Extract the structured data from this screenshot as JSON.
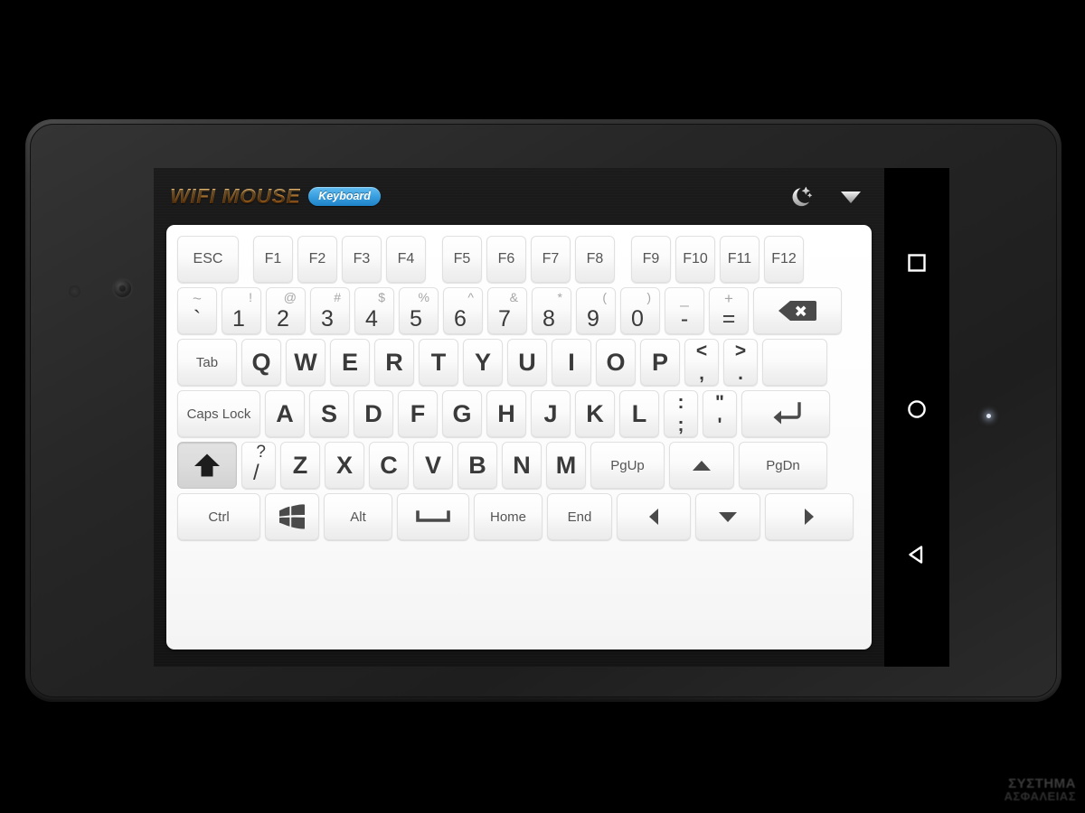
{
  "app": {
    "brand": "WIFI MOUSE",
    "mode_badge": "Keyboard",
    "icons": {
      "night_mode": "moon-icon",
      "dropdown": "chevron-down-icon"
    }
  },
  "colors": {
    "brand_orange": "#e09a3c",
    "badge_blue": "#3aa0e0",
    "key_face": "#fbfbfb",
    "key_pressed": "#dcdcdc",
    "panel_white": "#ffffff",
    "app_background": "#161616"
  },
  "keyboard": {
    "rows": [
      {
        "name": "function-row",
        "keys": [
          {
            "name": "esc",
            "label": "ESC",
            "style": "fn",
            "width": 68
          },
          {
            "gap": 16
          },
          {
            "name": "f1",
            "label": "F1",
            "style": "fn",
            "width": 44
          },
          {
            "name": "f2",
            "label": "F2",
            "style": "fn",
            "width": 44
          },
          {
            "name": "f3",
            "label": "F3",
            "style": "fn",
            "width": 44
          },
          {
            "name": "f4",
            "label": "F4",
            "style": "fn",
            "width": 44
          },
          {
            "gap": 18
          },
          {
            "name": "f5",
            "label": "F5",
            "style": "fn",
            "width": 44
          },
          {
            "name": "f6",
            "label": "F6",
            "style": "fn",
            "width": 44
          },
          {
            "name": "f7",
            "label": "F7",
            "style": "fn",
            "width": 44
          },
          {
            "name": "f8",
            "label": "F8",
            "style": "fn",
            "width": 44
          },
          {
            "gap": 18
          },
          {
            "name": "f9",
            "label": "F9",
            "style": "fn",
            "width": 44
          },
          {
            "name": "f10",
            "label": "F10",
            "style": "fn",
            "width": 44
          },
          {
            "name": "f11",
            "label": "F11",
            "style": "fn",
            "width": 44
          },
          {
            "name": "f12",
            "label": "F12",
            "style": "fn",
            "width": 44
          }
        ]
      },
      {
        "name": "number-row",
        "keys": [
          {
            "name": "backquote",
            "top": "~",
            "bottom": "`",
            "style": "dual-center",
            "width": 44
          },
          {
            "name": "digit-1",
            "top": "!",
            "bottom": "1",
            "style": "dual",
            "width": 44
          },
          {
            "name": "digit-2",
            "top": "@",
            "bottom": "2",
            "style": "dual",
            "width": 44
          },
          {
            "name": "digit-3",
            "top": "#",
            "bottom": "3",
            "style": "dual",
            "width": 44
          },
          {
            "name": "digit-4",
            "top": "$",
            "bottom": "4",
            "style": "dual",
            "width": 44
          },
          {
            "name": "digit-5",
            "top": "%",
            "bottom": "5",
            "style": "dual",
            "width": 44
          },
          {
            "name": "digit-6",
            "top": "^",
            "bottom": "6",
            "style": "dual",
            "width": 44
          },
          {
            "name": "digit-7",
            "top": "&",
            "bottom": "7",
            "style": "dual",
            "width": 44
          },
          {
            "name": "digit-8",
            "top": "*",
            "bottom": "8",
            "style": "dual",
            "width": 44
          },
          {
            "name": "digit-9",
            "top": "(",
            "bottom": "9",
            "style": "dual",
            "width": 44
          },
          {
            "name": "digit-0",
            "top": ")",
            "bottom": "0",
            "style": "dual",
            "width": 44
          },
          {
            "name": "minus",
            "top": "_",
            "bottom": "-",
            "style": "dual-center",
            "width": 44
          },
          {
            "name": "equal",
            "top": "+",
            "bottom": "=",
            "style": "dual-center",
            "width": 44
          },
          {
            "name": "backspace",
            "icon": "backspace-icon",
            "width": 98
          }
        ]
      },
      {
        "name": "qwerty-row",
        "keys": [
          {
            "name": "tab",
            "label": "Tab",
            "style": "word",
            "width": 66
          },
          {
            "name": "key-q",
            "label": "Q",
            "style": "alpha",
            "width": 44
          },
          {
            "name": "key-w",
            "label": "W",
            "style": "alpha",
            "width": 44
          },
          {
            "name": "key-e",
            "label": "E",
            "style": "alpha",
            "width": 44
          },
          {
            "name": "key-r",
            "label": "R",
            "style": "alpha",
            "width": 44
          },
          {
            "name": "key-t",
            "label": "T",
            "style": "alpha",
            "width": 44
          },
          {
            "name": "key-y",
            "label": "Y",
            "style": "alpha",
            "width": 44
          },
          {
            "name": "key-u",
            "label": "U",
            "style": "alpha",
            "width": 44
          },
          {
            "name": "key-i",
            "label": "I",
            "style": "alpha",
            "width": 44
          },
          {
            "name": "key-o",
            "label": "O",
            "style": "alpha",
            "width": 44
          },
          {
            "name": "key-p",
            "label": "P",
            "style": "alpha",
            "width": 44
          },
          {
            "name": "bracket-left",
            "top": "<",
            "bottom": ",",
            "style": "dual-stack",
            "width": 38
          },
          {
            "name": "bracket-right",
            "top": ">",
            "bottom": ".",
            "style": "dual-stack",
            "width": 38
          },
          {
            "name": "backslash",
            "label": "",
            "style": "word",
            "width": 72
          }
        ]
      },
      {
        "name": "home-row",
        "keys": [
          {
            "name": "caps-lock",
            "label": "Caps Lock",
            "style": "word",
            "width": 92
          },
          {
            "name": "key-a",
            "label": "A",
            "style": "alpha",
            "width": 44
          },
          {
            "name": "key-s",
            "label": "S",
            "style": "alpha",
            "width": 44
          },
          {
            "name": "key-d",
            "label": "D",
            "style": "alpha",
            "width": 44
          },
          {
            "name": "key-f",
            "label": "F",
            "style": "alpha",
            "width": 44
          },
          {
            "name": "key-g",
            "label": "G",
            "style": "alpha",
            "width": 44
          },
          {
            "name": "key-h",
            "label": "H",
            "style": "alpha",
            "width": 44
          },
          {
            "name": "key-j",
            "label": "J",
            "style": "alpha",
            "width": 44
          },
          {
            "name": "key-k",
            "label": "K",
            "style": "alpha",
            "width": 44
          },
          {
            "name": "key-l",
            "label": "L",
            "style": "alpha",
            "width": 44
          },
          {
            "name": "semicolon",
            "top": ":",
            "bottom": ";",
            "style": "dual-stack",
            "width": 38
          },
          {
            "name": "quote",
            "top": "\"",
            "bottom": "'",
            "style": "dual-stack",
            "width": 38
          },
          {
            "name": "enter",
            "icon": "enter-icon",
            "width": 98
          }
        ]
      },
      {
        "name": "shift-row",
        "keys": [
          {
            "name": "shift",
            "icon": "shift-up-arrow-icon",
            "width": 66,
            "pressed": true
          },
          {
            "name": "slash",
            "top": "?",
            "bottom": "/",
            "style": "dual-slash",
            "width": 38
          },
          {
            "name": "key-z",
            "label": "Z",
            "style": "alpha",
            "width": 44
          },
          {
            "name": "key-x",
            "label": "X",
            "style": "alpha",
            "width": 44
          },
          {
            "name": "key-c",
            "label": "C",
            "style": "alpha",
            "width": 44
          },
          {
            "name": "key-v",
            "label": "V",
            "style": "alpha",
            "width": 44
          },
          {
            "name": "key-b",
            "label": "B",
            "style": "alpha",
            "width": 44
          },
          {
            "name": "key-n",
            "label": "N",
            "style": "alpha",
            "width": 44
          },
          {
            "name": "key-m",
            "label": "M",
            "style": "alpha",
            "width": 44
          },
          {
            "name": "page-up",
            "label": "PgUp",
            "style": "word",
            "width": 82
          },
          {
            "name": "arrow-up",
            "icon": "arrow-up-icon",
            "width": 72
          },
          {
            "name": "page-down",
            "label": "PgDn",
            "style": "word",
            "width": 98
          }
        ]
      },
      {
        "name": "bottom-row",
        "keys": [
          {
            "name": "ctrl",
            "label": "Ctrl",
            "style": "word",
            "width": 92
          },
          {
            "name": "windows",
            "icon": "windows-logo-icon",
            "width": 60
          },
          {
            "name": "alt",
            "label": "Alt",
            "style": "word",
            "width": 76
          },
          {
            "name": "space",
            "icon": "space-icon",
            "width": 80
          },
          {
            "name": "home",
            "label": "Home",
            "style": "word",
            "width": 76
          },
          {
            "name": "end",
            "label": "End",
            "style": "word",
            "width": 72
          },
          {
            "name": "arrow-left",
            "icon": "arrow-left-icon",
            "width": 82
          },
          {
            "name": "arrow-down",
            "icon": "arrow-down-icon",
            "width": 72
          },
          {
            "name": "arrow-right",
            "icon": "arrow-right-icon",
            "width": 98
          }
        ]
      }
    ]
  },
  "device": {
    "nav_buttons": [
      {
        "name": "recents-button",
        "icon": "square-icon"
      },
      {
        "name": "home-button",
        "icon": "circle-icon"
      },
      {
        "name": "back-button",
        "icon": "triangle-left-icon"
      }
    ]
  },
  "watermark": {
    "line1": "ΣΥΣΤΗΜΑ",
    "line2": "ΑΣΦΑΛΕΙΑΣ"
  }
}
